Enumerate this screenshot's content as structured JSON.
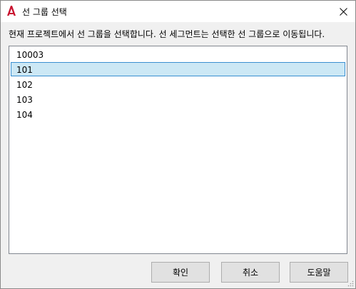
{
  "window": {
    "title": "선 그룹 선택",
    "icon": "autocad-icon",
    "accent_color": "#c8102e"
  },
  "instruction": "현재 프로젝트에서 선 그룹을 선택합니다. 선 세그먼트는 선택한 선 그룹으로 이동됩니다.",
  "list": {
    "items": [
      "10003",
      "101",
      "102",
      "103",
      "104"
    ],
    "selected": "101"
  },
  "buttons": {
    "ok_label": "확인",
    "cancel_label": "취소",
    "help_label": "도움말"
  }
}
